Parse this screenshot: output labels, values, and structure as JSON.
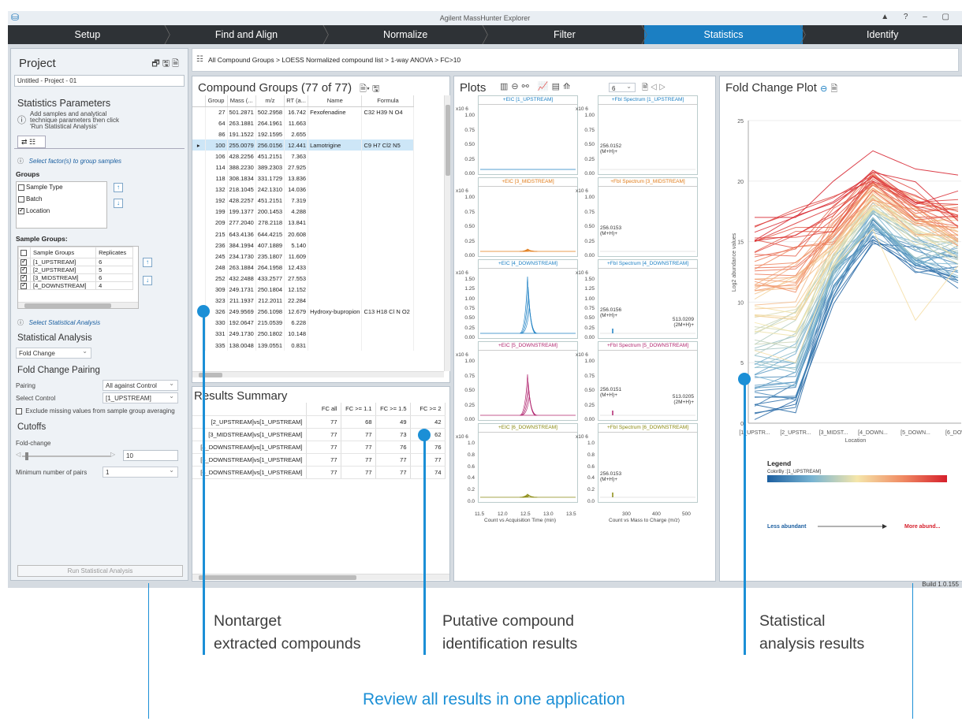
{
  "window": {
    "title": "Agilent MassHunter Explorer",
    "controls": "▲ ? – ▢"
  },
  "workflow": [
    "Setup",
    "Find and Align",
    "Normalize",
    "Filter",
    "Statistics",
    "Identify"
  ],
  "workflow_active": 4,
  "breadcrumb": "All Compound Groups > LOESS Normalized compound list > 1-way ANOVA > FC>10",
  "project": {
    "title": "Project",
    "name": "Untitled - Project - 01"
  },
  "stat_params": {
    "title": "Statistics Parameters",
    "hint": "Add samples and analytical technique parameters then click 'Run Statistical Analysis'",
    "factor_hint": "Select factor(s) to group samples",
    "groups_label": "Groups",
    "groups": [
      {
        "label": "Sample Type",
        "checked": false
      },
      {
        "label": "Batch",
        "checked": false
      },
      {
        "label": "Location",
        "checked": true
      }
    ],
    "sample_groups_label": "Sample Groups:",
    "sg_headers": [
      "Sample Groups",
      "Replicates"
    ],
    "sample_groups": [
      {
        "name": "[1_UPSTREAM]",
        "rep": "6"
      },
      {
        "name": "[2_UPSTREAM]",
        "rep": "5"
      },
      {
        "name": "[3_MIDSTREAM]",
        "rep": "6"
      },
      {
        "name": "[4_DOWNSTREAM]",
        "rep": "4"
      }
    ],
    "stat_hint": "Select Statistical Analysis",
    "stat_title": "Statistical Analysis",
    "stat_value": "Fold Change",
    "fcp_title": "Fold Change Pairing",
    "pairing_label": "Pairing",
    "pairing_value": "All against Control",
    "control_label": "Select Control",
    "control_value": "[1_UPSTREAM]",
    "exclude_label": "Exclude missing values from sample group averaging",
    "cutoffs": "Cutoffs",
    "fc_label": "Fold-change",
    "fc_value": "10",
    "minpairs_label": "Minimum number of pairs",
    "minpairs_value": "1",
    "run_button": "Run Statistical Analysis"
  },
  "compound_groups": {
    "title": "Compound Groups (77 of 77)",
    "headers": [
      "Group",
      "Mass (...",
      "m/z",
      "RT (a...",
      "Name",
      "Formula"
    ],
    "rows": [
      [
        "27",
        "501.2871",
        "502.2958",
        "16.742",
        "Fexofenadine",
        "C32 H39 N O4"
      ],
      [
        "64",
        "263.1881",
        "264.1961",
        "11.663",
        "",
        ""
      ],
      [
        "86",
        "191.1522",
        "192.1595",
        "2.655",
        "",
        ""
      ],
      [
        "100",
        "255.0079",
        "256.0156",
        "12.441",
        "Lamotrigine",
        "C9 H7 Cl2 N5"
      ],
      [
        "106",
        "428.2256",
        "451.2151",
        "7.363",
        "",
        ""
      ],
      [
        "114",
        "388.2230",
        "389.2303",
        "27.925",
        "",
        ""
      ],
      [
        "118",
        "308.1834",
        "331.1729",
        "13.836",
        "",
        ""
      ],
      [
        "132",
        "218.1045",
        "242.1310",
        "14.036",
        "",
        ""
      ],
      [
        "192",
        "428.2257",
        "451.2151",
        "7.319",
        "",
        ""
      ],
      [
        "199",
        "199.1377",
        "200.1453",
        "4.288",
        "",
        ""
      ],
      [
        "209",
        "277.2040",
        "278.2118",
        "13.841",
        "",
        ""
      ],
      [
        "215",
        "643.4136",
        "644.4215",
        "20.608",
        "",
        ""
      ],
      [
        "236",
        "384.1994",
        "407.1889",
        "5.140",
        "",
        ""
      ],
      [
        "245",
        "234.1730",
        "235.1807",
        "11.609",
        "",
        ""
      ],
      [
        "248",
        "263.1884",
        "264.1958",
        "12.433",
        "",
        ""
      ],
      [
        "252",
        "432.2488",
        "433.2577",
        "27.553",
        "",
        ""
      ],
      [
        "309",
        "249.1731",
        "250.1804",
        "12.152",
        "",
        ""
      ],
      [
        "323",
        "211.1937",
        "212.2011",
        "22.284",
        "",
        ""
      ],
      [
        "326",
        "249.9569",
        "256.1098",
        "12.679",
        "Hydroxy-bupropion",
        "C13 H18 Cl N O2"
      ],
      [
        "330",
        "192.0647",
        "215.0539",
        "6.228",
        "",
        ""
      ],
      [
        "331",
        "249.1730",
        "250.1802",
        "10.148",
        "",
        ""
      ],
      [
        "335",
        "138.0048",
        "139.0551",
        "0.831",
        "",
        ""
      ]
    ],
    "selected": 3
  },
  "results": {
    "title": "Results Summary",
    "headers": [
      "",
      "FC all",
      "FC >= 1.1",
      "FC >= 1.5",
      "FC >= 2"
    ],
    "rows": [
      [
        "[2_UPSTREAM]vs[1_UPSTREAM]",
        "77",
        "68",
        "49",
        "42"
      ],
      [
        "[3_MIDSTREAM]vs[1_UPSTREAM]",
        "77",
        "77",
        "73",
        "62"
      ],
      [
        "[4_DOWNSTREAM]vs[1_UPSTREAM]",
        "77",
        "77",
        "76",
        "76"
      ],
      [
        "[5_DOWNSTREAM]vs[1_UPSTREAM]",
        "77",
        "77",
        "77",
        "77"
      ],
      [
        "[6_DOWNSTREAM]vs[1_UPSTREAM]",
        "77",
        "77",
        "77",
        "74"
      ]
    ]
  },
  "plots": {
    "title": "Plots",
    "count": "6",
    "exp": "x10 6",
    "rows": [
      {
        "eic": "+EIC [1_UPSTREAM]",
        "spec": "+FbI Spectrum [1_UPSTREAM]",
        "color": "#1b7fc3",
        "yt": [
          "1.00",
          "0.75",
          "0.50",
          "0.25",
          "0.00"
        ],
        "peak": "256.0152",
        "ion": "(M+H)+",
        "peak2": "",
        "ion2": ""
      },
      {
        "eic": "+EIC [3_MIDSTREAM]",
        "spec": "+FbI Spectrum [3_MIDSTREAM]",
        "color": "#e07b18",
        "yt": [
          "1.00",
          "0.75",
          "0.50",
          "0.25",
          "0.00"
        ],
        "peak": "256.0153",
        "ion": "(M+H)+",
        "peak2": "",
        "ion2": ""
      },
      {
        "eic": "+EIC [4_DOWNSTREAM]",
        "spec": "+FbI Spectrum [4_DOWNSTREAM]",
        "color": "#1b7fc3",
        "yt": [
          "1.50",
          "1.25",
          "1.00",
          "0.75",
          "0.50",
          "0.25",
          "0.00"
        ],
        "peak": "256.0156",
        "ion": "(M+H)+",
        "peak2": "513.0209",
        "ion2": "(2M+H)+"
      },
      {
        "eic": "+EIC [5_DOWNSTREAM]",
        "spec": "+FbI Spectrum [5_DOWNSTREAM]",
        "color": "#b0246e",
        "yt": [
          "1.00",
          "0.75",
          "0.50",
          "0.25",
          "0.00"
        ],
        "peak": "256.0151",
        "ion": "(M+H)+",
        "peak2": "513.0205",
        "ion2": "(2M+H)+"
      },
      {
        "eic": "+EIC [6_DOWNSTREAM]",
        "spec": "+FbI Spectrum [6_DOWNSTREAM]",
        "color": "#8a8a10",
        "yt": [
          "1.0",
          "0.8",
          "0.6",
          "0.4",
          "0.2",
          "0.0"
        ],
        "peak": "256.0153",
        "ion": "(M+H)+",
        "peak2": "",
        "ion2": ""
      }
    ],
    "eic_xticks": [
      "11.5",
      "12.0",
      "12.5",
      "13.0",
      "13.5"
    ],
    "eic_xlabel": "Count vs Acquisition Time (min)",
    "spec_xticks": [
      "300",
      "400",
      "500"
    ],
    "spec_xlabel": "Count vs Mass to Charge (m/z)"
  },
  "fold_change": {
    "title": "Fold Change Plot",
    "ylabel": "Log2 abundance values",
    "xlabel": "Location",
    "yticks": [
      "25",
      "20",
      "15",
      "10",
      "5",
      "0"
    ],
    "xticks": [
      "[1_UPSTR...",
      "[2_UPSTR...",
      "[3_MIDST...",
      "[4_DOWN...",
      "[5_DOWN...",
      "[6_DOWN"
    ],
    "legend_title": "Legend",
    "legend_sub": "ColorBy :[1_UPSTREAM]",
    "less": "Less abundant",
    "more": "More abund...",
    "low_color": "#1c5fa0",
    "high_color": "#d6202c"
  },
  "build": "Build 1.0.155",
  "captions": {
    "c1a": "Nontarget",
    "c1b": "extracted compounds",
    "c2a": "Putative compound",
    "c2b": "identification results",
    "c3a": "Statistical",
    "c3b": "analysis results",
    "main": "Review all results in one application"
  },
  "chart_data": {
    "type": "line",
    "title": "Fold Change Plot",
    "xlabel": "Location",
    "ylabel": "Log2 abundance values",
    "categories": [
      "[1_UPSTR...",
      "[2_UPSTR...",
      "[3_MIDST...",
      "[4_DOWN...",
      "[5_DOWN...",
      "[6_DOWN"
    ],
    "ylim": [
      0,
      25
    ],
    "series_note": "77 compound profiles colored from less abundant (blue) to more abundant (red)"
  }
}
